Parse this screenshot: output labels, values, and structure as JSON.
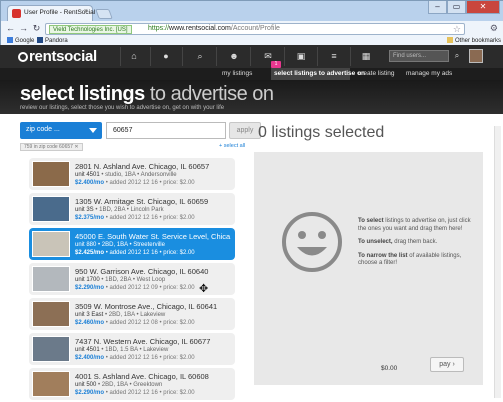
{
  "browser": {
    "tab_title": "User Profile - RentSocial",
    "tab_close": "×",
    "window_buttons": [
      "–",
      "▭",
      "✕"
    ],
    "ev_badge": "Vield Technologies Inc. [US]",
    "url_scheme": "https://",
    "url_host": "www.rentsocial.com",
    "url_path": "/Account/Profile",
    "bookmarks": [
      "Google",
      "Pandora"
    ],
    "other_bookmarks": "Other bookmarks"
  },
  "site": {
    "logo": "rentsocial",
    "search_placeholder": "Find users...",
    "message_badge": "1",
    "subnav": [
      "my listings",
      "select listings to advertise on",
      "create listing",
      "manage my ads"
    ]
  },
  "hero": {
    "title_bold": "select listings",
    "title_rest": "to advertise on",
    "subtitle": "review our listings, select those you wish to advertise on, get on with your life"
  },
  "filters": {
    "zip_select": "zip code ...",
    "zip_value": "60657",
    "apply": "apply",
    "chip": "759 in zip code 60657 ✕",
    "select_all": "+ select all"
  },
  "listings": [
    {
      "address": "2801 N. Ashland Ave. Chicago, IL 60657",
      "unit": "unit 4501",
      "details": "studio, 1BA • Andersonville",
      "price": "$2.400/mo",
      "added": "added 2012 12 16 • price: $2.00",
      "photo": "#8b6a4a"
    },
    {
      "address": "1305 W. Armitage St. Chicago, IL 60659",
      "unit": "unit 3S",
      "details": "1BD, 2BA • Lincoln Park",
      "price": "$2.375/mo",
      "added": "added 2012 12 16 • price: $2.00",
      "photo": "#4a6b8c"
    },
    {
      "address": "45000 E. South Water St. Service Level, Chica...",
      "unit": "unit 880",
      "details": "2BD, 1BA • Streeterville",
      "price": "$2.425/mo",
      "added": "added 2012 12 16 • price: $2.00",
      "photo": "#c9c4b8"
    },
    {
      "address": "950 W. Garrison Ave. Chicago, IL 60640",
      "unit": "unit 1700",
      "details": "1BD, 2BA • West Loop",
      "price": "$2.290/mo",
      "added": "added 2012 12 09 • price: $2.00",
      "photo": "#b3b8bd"
    },
    {
      "address": "3509 W. Montrose Ave., Chicago, IL 60641",
      "unit": "unit 3 East",
      "details": "2BD, 1BA • Lakeview",
      "price": "$2.460/mo",
      "added": "added 2012 12 08 • price: $2.00",
      "photo": "#8c6f55"
    },
    {
      "address": "7437 N. Western Ave. Chicago, IL 60677",
      "unit": "unit 4501",
      "details": "1BD, 1.5 BA • Lakeview",
      "price": "$2.400/mo",
      "added": "added 2012 12 16 • price: $2.00",
      "photo": "#6b7a8a"
    },
    {
      "address": "4001 S. Ashland Ave. Chicago, IL 60608",
      "unit": "unit 500",
      "details": "2BD, 1BA • Greektown",
      "price": "$2.290/mo",
      "added": "added 2012 12 16 • price: $2.00",
      "photo": "#a17e5c"
    }
  ],
  "selection": {
    "title": "0 listings selected",
    "help_1_bold": "To select",
    "help_1_rest": "listings to advertise on, just click the ones you want and drag them here!",
    "help_2_bold": "To unselect,",
    "help_2_rest": "drag them back.",
    "help_3_bold": "To narrow the list",
    "help_3_rest": "of available listings, choose a filter!",
    "total": "$0.00",
    "pay": "pay ›"
  }
}
